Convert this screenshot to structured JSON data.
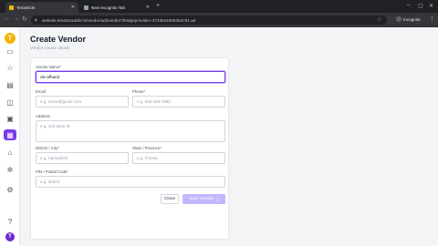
{
  "browser": {
    "tabs": [
      {
        "label": "Tenanticle",
        "favicon_color": "#f5b400"
      },
      {
        "label": "New Incognito Tab",
        "favicon_color": "#9aa0a6"
      }
    ],
    "url": "website.tenantcaddle.hi/vendor/addvendor?bridgeprovider=372384180635a791.ad",
    "profile_label": "Incognito"
  },
  "sidebar": {
    "logo": "T",
    "avatar": "T",
    "items": [
      {
        "icon": "inbox-icon",
        "glyph": "▭"
      },
      {
        "icon": "star-icon",
        "glyph": "☆"
      },
      {
        "icon": "document-icon",
        "glyph": "▤"
      },
      {
        "icon": "message-icon",
        "glyph": "◫"
      },
      {
        "icon": "briefcase-icon",
        "glyph": "▣"
      },
      {
        "icon": "vendor-icon",
        "glyph": "▦"
      },
      {
        "icon": "lock-icon",
        "glyph": "⌂"
      },
      {
        "icon": "network-icon",
        "glyph": "✲"
      },
      {
        "icon": "settings-icon",
        "glyph": "⚙"
      },
      {
        "icon": "help-icon",
        "glyph": "?"
      }
    ]
  },
  "header": {
    "title": "Create Vendor",
    "subtitle": "Vendor Create details"
  },
  "form": {
    "vendor_name": {
      "label": "Vendor Name*",
      "value": "ole afhand"
    },
    "email": {
      "label": "Email",
      "placeholder": "e.g. name@gmail.com"
    },
    "phone": {
      "label": "Phone*",
      "placeholder": "e.g. 555-456-7890"
    },
    "address": {
      "label": "Address",
      "placeholder": "e.g. 123 Main St"
    },
    "city": {
      "label": "District / City*",
      "placeholder": "e.g. Springfield"
    },
    "state": {
      "label": "State / Province*",
      "placeholder": "e.g. Florida"
    },
    "postal": {
      "label": "PIN / Postal Code*",
      "placeholder": "e.g. 32504"
    },
    "cancel_label": "Close",
    "create_label": "Save Vendor"
  },
  "colors": {
    "accent": "#7c3aed",
    "accent_light": "#c4b5fd",
    "logo": "#f5b400"
  }
}
